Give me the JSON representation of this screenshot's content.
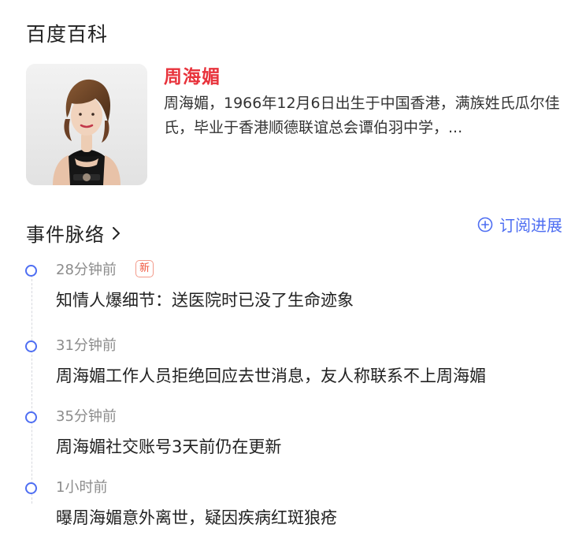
{
  "source": {
    "title": "百度百科"
  },
  "profile": {
    "name": "周海媚",
    "summary": "周海媚，1966年12月6日出生于中国香港，满族姓氏瓜尔佳氏，毕业于香港顺德联谊总会谭伯羽中学，..."
  },
  "events": {
    "title": "事件脉络",
    "subscribe_label": "订阅进展",
    "items": [
      {
        "time": "28分钟前",
        "badge": "新",
        "headline": "知情人爆细节：送医院时已没了生命迹象"
      },
      {
        "time": "31分钟前",
        "headline": "周海媚工作人员拒绝回应去世消息，友人称联系不上周海媚"
      },
      {
        "time": "35分钟前",
        "headline": "周海媚社交账号3天前仍在更新"
      },
      {
        "time": "1小时前",
        "headline": "曝周海媚意外离世，疑因疾病红斑狼疮"
      }
    ]
  },
  "colors": {
    "name_red": "#e8333c",
    "accent_blue": "#4e6ef2",
    "muted_gray": "#8c8c8c",
    "badge_red": "#f0563d"
  },
  "icons": {
    "section_arrow": "chevron-right-icon",
    "subscribe": "plus-circle-icon",
    "timeline_node": "timeline-dot-icon"
  }
}
